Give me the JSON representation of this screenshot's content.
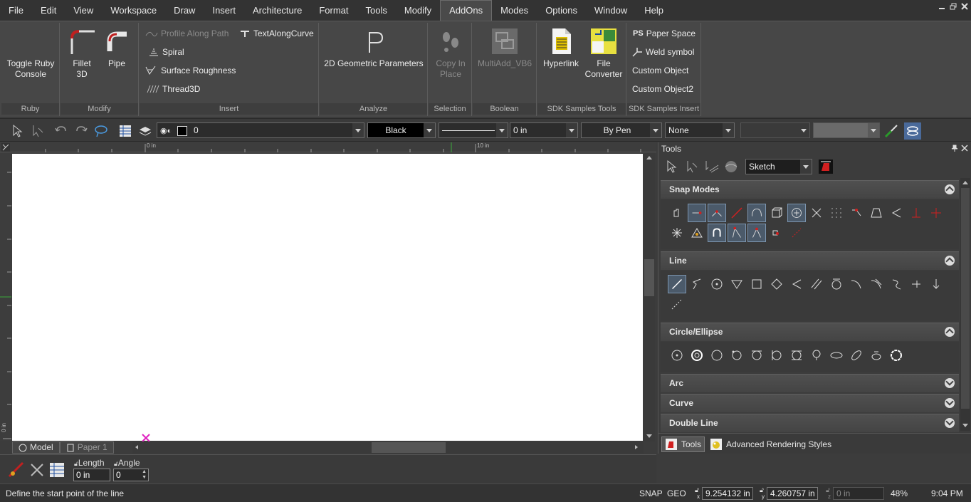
{
  "menu": {
    "items": [
      "File",
      "Edit",
      "View",
      "Workspace",
      "Draw",
      "Insert",
      "Architecture",
      "Format",
      "Tools",
      "Modify",
      "AddOns",
      "Modes",
      "Options",
      "Window",
      "Help"
    ],
    "active": "AddOns"
  },
  "ribbon": {
    "groups": {
      "ruby": "Ruby",
      "modify": "Modify",
      "insert": "Insert",
      "analyze": "Analyze",
      "selection": "Selection",
      "boolean": "Boolean",
      "sdk_tools": "SDK Samples Tools",
      "sdk_insert": "SDK Samples Insert"
    },
    "toggle_ruby_1": "Toggle Ruby",
    "toggle_ruby_2": "Console",
    "fillet_1": "Fillet",
    "fillet_2": "3D",
    "pipe": "Pipe",
    "profile_along_path": "Profile Along Path",
    "text_along_curve": "TextAlongCurve",
    "spiral": "Spiral",
    "surface_roughness": "Surface Roughness",
    "thread3d": "Thread3D",
    "geo_params": "2D Geometric Parameters",
    "copy_in_place_1": "Copy In",
    "copy_in_place_2": "Place",
    "multiadd": "MultiAdd_VB6",
    "hyperlink": "Hyperlink",
    "file_converter_1": "File",
    "file_converter_2": "Converter",
    "paper_space_prefix": "PS",
    "paper_space": "Paper Space",
    "weld_symbol": "Weld symbol",
    "custom_object": "Custom Object",
    "custom_object2": "Custom Object2"
  },
  "toolbar": {
    "layer_value": "0",
    "color_value": "Black",
    "line_width_value": "0 in",
    "pen_value": "By Pen",
    "fill_value": "None"
  },
  "drawing": {
    "ruler_h_0": "0 in",
    "ruler_h_10": "10 in",
    "ruler_v_0": "0 in",
    "tab_model": "Model",
    "tab_paper": "Paper 1"
  },
  "command": {
    "length_label": "Length",
    "length_value": "0 in",
    "angle_label": "Angle",
    "angle_value": "0"
  },
  "status": {
    "prompt": "Define the start point of the line",
    "snap": "SNAP",
    "geo": "GEO",
    "x_label": "x",
    "x_value": "9.254132 in",
    "y_label": "y",
    "y_value": "4.260757 in",
    "z_label": "z",
    "z_value": "0 in",
    "zoom": "48%",
    "time": "9:04 PM"
  },
  "tools_panel": {
    "title": "Tools",
    "mode_value": "Sketch",
    "sections": {
      "snap": "Snap Modes",
      "line": "Line",
      "circle": "Circle/Ellipse",
      "arc": "Arc",
      "curve": "Curve",
      "double_line": "Double Line"
    },
    "tab_tools": "Tools",
    "tab_rendering": "Advanced Rendering Styles"
  },
  "colors": {
    "accent_red": "#d92020",
    "selected_border": "#7c95b0"
  }
}
